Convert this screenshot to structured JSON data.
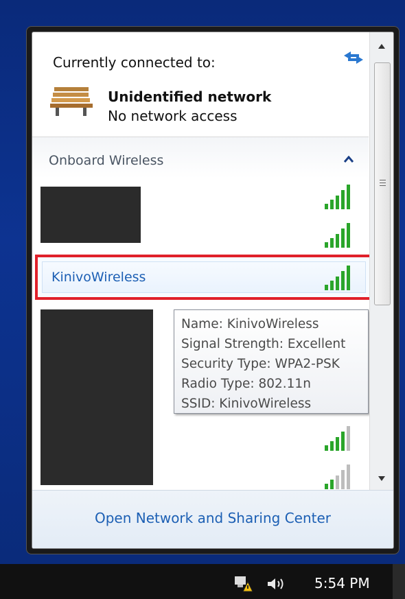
{
  "panel": {
    "connected_title": "Currently connected to:",
    "current_network": {
      "name": "Unidentified network",
      "status": "No network access",
      "icon": "bench-icon"
    },
    "section_label": "Onboard Wireless",
    "selected_network": "KinivoWireless",
    "tooltip": {
      "name": "Name: KinivoWireless",
      "signal": "Signal Strength: Excellent",
      "security": "Security Type: WPA2-PSK",
      "radio": "Radio Type: 802.11n",
      "ssid": "SSID: KinivoWireless"
    },
    "footer_link": "Open Network and Sharing Center"
  },
  "taskbar": {
    "clock": "5:54 PM"
  },
  "colors": {
    "link": "#1c5fb4",
    "signal_green": "#2aa52a",
    "highlight": "#e0202a"
  }
}
